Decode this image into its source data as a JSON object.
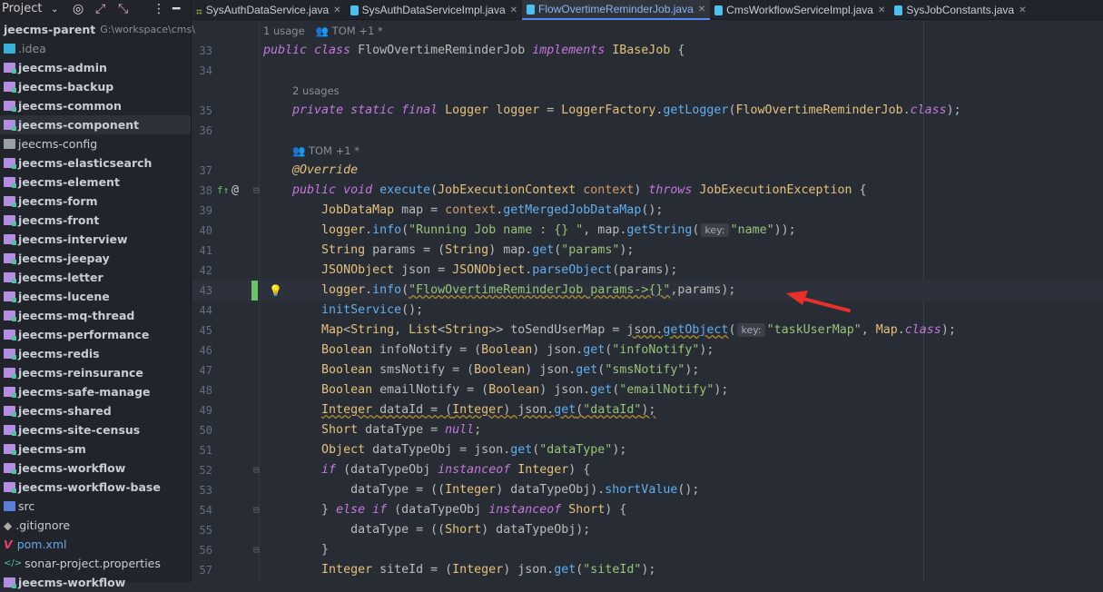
{
  "sidebar": {
    "header": {
      "title": "Project",
      "icons": [
        "target-icon",
        "expand-icon",
        "collapse-icon",
        "more-icon",
        "minimize-icon"
      ]
    },
    "root": {
      "name": "jeecms-parent",
      "path": "G:\\workspace\\cms\\"
    },
    "items": [
      {
        "label": ".idea",
        "icon": "idea",
        "bold": false
      },
      {
        "label": "jeecms-admin",
        "icon": "mod",
        "bold": true
      },
      {
        "label": "jeecms-backup",
        "icon": "mod",
        "bold": true
      },
      {
        "label": "jeecms-common",
        "icon": "mod",
        "bold": true
      },
      {
        "label": "jeecms-component",
        "icon": "mod",
        "bold": true,
        "selected": true
      },
      {
        "label": "jeecms-config",
        "icon": "plain",
        "bold": false
      },
      {
        "label": "jeecms-elasticsearch",
        "icon": "mod",
        "bold": true
      },
      {
        "label": "jeecms-element",
        "icon": "mod",
        "bold": true
      },
      {
        "label": "jeecms-form",
        "icon": "mod",
        "bold": true
      },
      {
        "label": "jeecms-front",
        "icon": "mod",
        "bold": true
      },
      {
        "label": "jeecms-interview",
        "icon": "mod",
        "bold": true
      },
      {
        "label": "jeecms-jeepay",
        "icon": "mod",
        "bold": true
      },
      {
        "label": "jeecms-letter",
        "icon": "mod",
        "bold": true
      },
      {
        "label": "jeecms-lucene",
        "icon": "mod",
        "bold": true
      },
      {
        "label": "jeecms-mq-thread",
        "icon": "mod",
        "bold": true
      },
      {
        "label": "jeecms-performance",
        "icon": "mod",
        "bold": true
      },
      {
        "label": "jeecms-redis",
        "icon": "mod",
        "bold": true
      },
      {
        "label": "jeecms-reinsurance",
        "icon": "mod",
        "bold": true
      },
      {
        "label": "jeecms-safe-manage",
        "icon": "mod",
        "bold": true
      },
      {
        "label": "jeecms-shared",
        "icon": "mod",
        "bold": true
      },
      {
        "label": "jeecms-site-census",
        "icon": "mod",
        "bold": true
      },
      {
        "label": "jeecms-sm",
        "icon": "mod",
        "bold": true
      },
      {
        "label": "jeecms-workflow",
        "icon": "mod",
        "bold": true
      },
      {
        "label": "jeecms-workflow-base",
        "icon": "mod",
        "bold": true
      },
      {
        "label": "src",
        "icon": "src",
        "bold": false
      },
      {
        "label": ".gitignore",
        "icon": "git",
        "bold": false
      },
      {
        "label": "pom.xml",
        "icon": "maven",
        "bold": false,
        "blue": true
      },
      {
        "label": "sonar-project.properties",
        "icon": "props",
        "bold": false
      },
      {
        "label": "jeecms-workflow",
        "icon": "mod",
        "bold": true
      }
    ]
  },
  "tabs": [
    {
      "label": "SysAuthDataService.java",
      "icon": "interface",
      "active": false
    },
    {
      "label": "SysAuthDataServiceImpl.java",
      "icon": "class",
      "active": false
    },
    {
      "label": "FlowOvertimeReminderJob.java",
      "icon": "class",
      "active": true
    },
    {
      "label": "CmsWorkflowServiceImpl.java",
      "icon": "class",
      "active": false
    },
    {
      "label": "SysJobConstants.java",
      "icon": "class",
      "active": false
    }
  ],
  "editor": {
    "rows": [
      {
        "hint": "1 usage",
        "author": "TOM +1 *",
        "indent": 0
      },
      {
        "num": "33",
        "tokens": [
          [
            "kw",
            "public class "
          ],
          [
            "",
            "FlowOvertimeReminderJob "
          ],
          [
            "kw",
            "implements "
          ],
          [
            "ty",
            "IBaseJob"
          ],
          [
            "",
            " {"
          ]
        ]
      },
      {
        "num": "34",
        "tokens": []
      },
      {
        "hint": "2 usages",
        "indent": 4
      },
      {
        "num": "35",
        "tokens": [
          [
            "",
            "    "
          ],
          [
            "kw",
            "private static final "
          ],
          [
            "ty",
            "Logger "
          ],
          [
            "fl",
            "logger"
          ],
          [
            "",
            " = "
          ],
          [
            "ty",
            "LoggerFactory"
          ],
          [
            "",
            "."
          ],
          [
            "fn",
            "getLogger"
          ],
          [
            "",
            "("
          ],
          [
            "ty",
            "FlowOvertimeReminderJob"
          ],
          [
            "",
            "."
          ],
          [
            "kw",
            "class"
          ],
          [
            "",
            ");"
          ]
        ]
      },
      {
        "num": "36",
        "tokens": []
      },
      {
        "author": "TOM +1 *",
        "indent": 4
      },
      {
        "num": "37",
        "tokens": [
          [
            "",
            "    "
          ],
          [
            "an",
            "@Override"
          ]
        ]
      },
      {
        "num": "38",
        "gutterIcons": true,
        "tokens": [
          [
            "",
            "    "
          ],
          [
            "kw",
            "public void "
          ],
          [
            "fn",
            "execute"
          ],
          [
            "",
            "("
          ],
          [
            "ty",
            "JobExecutionContext "
          ],
          [
            "pa",
            "context"
          ],
          [
            "",
            ") "
          ],
          [
            "kw",
            "throws "
          ],
          [
            "ty",
            "JobExecutionException"
          ],
          [
            "",
            " {"
          ]
        ]
      },
      {
        "num": "39",
        "tokens": [
          [
            "",
            "        "
          ],
          [
            "ty",
            "JobDataMap "
          ],
          [
            "",
            "map = "
          ],
          [
            "pa",
            "context"
          ],
          [
            "",
            "."
          ],
          [
            "fn",
            "getMergedJobDataMap"
          ],
          [
            "",
            "();"
          ]
        ]
      },
      {
        "num": "40",
        "tokens": [
          [
            "",
            "        "
          ],
          [
            "fl",
            "logger"
          ],
          [
            "",
            "."
          ],
          [
            "fn",
            "info"
          ],
          [
            "",
            "("
          ],
          [
            "st",
            "\"Running Job name : {} \""
          ],
          [
            "",
            ", map."
          ],
          [
            "fn",
            "getString"
          ],
          [
            "",
            "("
          ],
          [
            "hint",
            "key:"
          ],
          [
            "st",
            "\"name\""
          ],
          [
            "",
            "));"
          ]
        ]
      },
      {
        "num": "41",
        "tokens": [
          [
            "",
            "        "
          ],
          [
            "ty",
            "String "
          ],
          [
            "",
            "params = ("
          ],
          [
            "ty",
            "String"
          ],
          [
            "",
            ") map."
          ],
          [
            "fn",
            "get"
          ],
          [
            "",
            "("
          ],
          [
            "st",
            "\"params\""
          ],
          [
            "",
            ");"
          ]
        ]
      },
      {
        "num": "42",
        "tokens": [
          [
            "",
            "        "
          ],
          [
            "ty",
            "JSONObject "
          ],
          [
            "",
            "json = "
          ],
          [
            "ty",
            "JSONObject"
          ],
          [
            "",
            "."
          ],
          [
            "fn",
            "parseObject"
          ],
          [
            "",
            "(params);"
          ]
        ]
      },
      {
        "num": "43",
        "highlight": true,
        "bulb": true,
        "tokens": [
          [
            "",
            "        "
          ],
          [
            "fl",
            "logger"
          ],
          [
            "",
            "."
          ],
          [
            "fn",
            "info"
          ],
          [
            "",
            "("
          ],
          [
            "st warn",
            "\"FlowOvertimeReminderJob params->{}\""
          ],
          [
            "",
            ",params);"
          ]
        ]
      },
      {
        "num": "44",
        "tokens": [
          [
            "",
            "        "
          ],
          [
            "fn",
            "initService"
          ],
          [
            "",
            "();"
          ]
        ]
      },
      {
        "num": "45",
        "tokens": [
          [
            "",
            "        "
          ],
          [
            "ty",
            "Map"
          ],
          [
            "",
            "<"
          ],
          [
            "ty",
            "String"
          ],
          [
            "",
            ", "
          ],
          [
            "ty",
            "List"
          ],
          [
            "",
            "<"
          ],
          [
            "ty",
            "String"
          ],
          [
            "",
            ">> toSendUserMap = "
          ],
          [
            "warn",
            "json."
          ],
          [
            "fn warn",
            "getObject"
          ],
          [
            "",
            "("
          ],
          [
            "hint",
            "key:"
          ],
          [
            "st",
            "\"taskUserMap\""
          ],
          [
            "",
            ", "
          ],
          [
            "ty",
            "Map"
          ],
          [
            "",
            "."
          ],
          [
            "kw",
            "class"
          ],
          [
            "",
            ");"
          ]
        ]
      },
      {
        "num": "46",
        "tokens": [
          [
            "",
            "        "
          ],
          [
            "ty",
            "Boolean "
          ],
          [
            "",
            "infoNotify = ("
          ],
          [
            "ty",
            "Boolean"
          ],
          [
            "",
            ") json."
          ],
          [
            "fn",
            "get"
          ],
          [
            "",
            "("
          ],
          [
            "st",
            "\"infoNotify\""
          ],
          [
            "",
            ");"
          ]
        ]
      },
      {
        "num": "47",
        "tokens": [
          [
            "",
            "        "
          ],
          [
            "ty",
            "Boolean "
          ],
          [
            "",
            "smsNotify = ("
          ],
          [
            "ty",
            "Boolean"
          ],
          [
            "",
            ") json."
          ],
          [
            "fn",
            "get"
          ],
          [
            "",
            "("
          ],
          [
            "st",
            "\"smsNotify\""
          ],
          [
            "",
            ");"
          ]
        ]
      },
      {
        "num": "48",
        "tokens": [
          [
            "",
            "        "
          ],
          [
            "ty",
            "Boolean "
          ],
          [
            "",
            "emailNotify = ("
          ],
          [
            "ty",
            "Boolean"
          ],
          [
            "",
            ") json."
          ],
          [
            "fn",
            "get"
          ],
          [
            "",
            "("
          ],
          [
            "st",
            "\"emailNotify\""
          ],
          [
            "",
            ");"
          ]
        ]
      },
      {
        "num": "49",
        "tokens": [
          [
            "",
            "        "
          ],
          [
            "ty warn",
            "Integer "
          ],
          [
            "warn",
            "dataId = ("
          ],
          [
            "ty warn",
            "Integer"
          ],
          [
            "warn",
            ") json."
          ],
          [
            "fn warn",
            "get"
          ],
          [
            "warn",
            "("
          ],
          [
            "st warn",
            "\"dataId\""
          ],
          [
            "warn",
            ");"
          ]
        ]
      },
      {
        "num": "50",
        "tokens": [
          [
            "",
            "        "
          ],
          [
            "ty",
            "Short "
          ],
          [
            "",
            "dataType = "
          ],
          [
            "kw",
            "null"
          ],
          [
            "",
            ";"
          ]
        ]
      },
      {
        "num": "51",
        "tokens": [
          [
            "",
            "        "
          ],
          [
            "ty",
            "Object "
          ],
          [
            "",
            "dataTypeObj = json."
          ],
          [
            "fn",
            "get"
          ],
          [
            "",
            "("
          ],
          [
            "st",
            "\"dataType\""
          ],
          [
            "",
            ");"
          ]
        ]
      },
      {
        "num": "52",
        "fold": true,
        "tokens": [
          [
            "",
            "        "
          ],
          [
            "kw",
            "if "
          ],
          [
            "",
            "(dataTypeObj "
          ],
          [
            "kw",
            "instanceof "
          ],
          [
            "ty",
            "Integer"
          ],
          [
            "",
            ") {"
          ]
        ]
      },
      {
        "num": "53",
        "tokens": [
          [
            "",
            "            dataType = (("
          ],
          [
            "ty",
            "Integer"
          ],
          [
            "",
            ") dataTypeObj)."
          ],
          [
            "fn",
            "shortValue"
          ],
          [
            "",
            "();"
          ]
        ]
      },
      {
        "num": "54",
        "fold": true,
        "tokens": [
          [
            "",
            "        } "
          ],
          [
            "kw",
            "else if "
          ],
          [
            "",
            "(dataTypeObj "
          ],
          [
            "kw",
            "instanceof "
          ],
          [
            "ty",
            "Short"
          ],
          [
            "",
            ") {"
          ]
        ]
      },
      {
        "num": "55",
        "tokens": [
          [
            "",
            "            dataType = (("
          ],
          [
            "ty",
            "Short"
          ],
          [
            "",
            ") dataTypeObj);"
          ]
        ]
      },
      {
        "num": "56",
        "fold": true,
        "tokens": [
          [
            "",
            "        }"
          ]
        ]
      },
      {
        "num": "57",
        "tokens": [
          [
            "",
            "        "
          ],
          [
            "ty",
            "Integer "
          ],
          [
            "",
            "siteId = ("
          ],
          [
            "ty",
            "Integer"
          ],
          [
            "",
            ") json."
          ],
          [
            "fn",
            "get"
          ],
          [
            "",
            "("
          ],
          [
            "st",
            "\"siteId\""
          ],
          [
            "",
            ");"
          ]
        ]
      }
    ]
  },
  "colors": {
    "accent": "#568af2",
    "arrow": "#e8302a",
    "change_marker": "#6ac26a"
  }
}
